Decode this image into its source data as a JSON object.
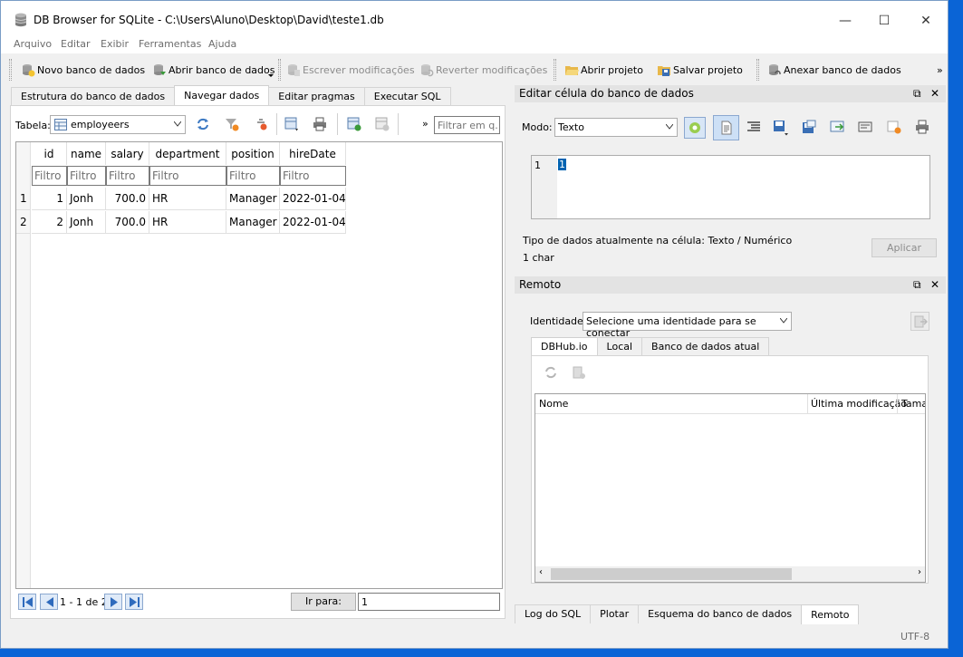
{
  "window": {
    "title": "DB Browser for SQLite - C:\\Users\\Aluno\\Desktop\\David\\teste1.db",
    "controls": {
      "minimize": "—",
      "maximize": "☐",
      "close": "✕"
    }
  },
  "menu": [
    "Arquivo",
    "Editar",
    "Exibir",
    "Ferramentas",
    "Ajuda"
  ],
  "toolbar": {
    "new_db": "Novo banco de dados",
    "open_db": "Abrir banco de dados",
    "write_changes": "Escrever modificações",
    "revert_changes": "Reverter modificações",
    "open_project": "Abrir projeto",
    "save_project": "Salvar projeto",
    "attach_db": "Anexar banco de dados",
    "more": "»"
  },
  "main_tabs": [
    "Estrutura do banco de dados",
    "Navegar dados",
    "Editar pragmas",
    "Executar SQL"
  ],
  "browse": {
    "table_label": "Tabela:",
    "table_value": "employeers",
    "more": "»",
    "filter_placeholder": "Filtrar em q...",
    "columns": [
      "id",
      "name",
      "salary",
      "department",
      "position",
      "hireDate"
    ],
    "filter_text": "Filtro",
    "rows": [
      {
        "num": "1",
        "cells": [
          "1",
          "Jonh",
          "700.0",
          "HR",
          "Manager",
          "2022-01-04"
        ]
      },
      {
        "num": "2",
        "cells": [
          "2",
          "Jonh",
          "700.0",
          "HR",
          "Manager",
          "2022-01-04"
        ]
      }
    ],
    "record_info": "1 - 1 de 2",
    "goto_label": "Ir para:",
    "goto_value": "1"
  },
  "edit_cell": {
    "title": "Editar célula do banco de dados",
    "mode_label": "Modo:",
    "mode_value": "Texto",
    "line_number": "1",
    "cell_value": "1",
    "type_text": "Tipo de dados atualmente na célula: Texto / Numérico",
    "size_text": "1 char",
    "apply": "Aplicar"
  },
  "remote": {
    "title": "Remoto",
    "identity_label": "Identidade",
    "identity_value": "Selecione uma identidade para se conectar",
    "tabs": [
      "DBHub.io",
      "Local",
      "Banco de dados atual"
    ],
    "columns": [
      "Nome",
      "Última modificação",
      "Tama"
    ]
  },
  "bottom_tabs": [
    "Log do SQL",
    "Plotar",
    "Esquema do banco de dados",
    "Remoto"
  ],
  "status": {
    "encoding": "UTF-8"
  },
  "colors": {
    "accent": "#0078d7",
    "desktop": "#0a64d6",
    "selection": "#0063b1"
  }
}
